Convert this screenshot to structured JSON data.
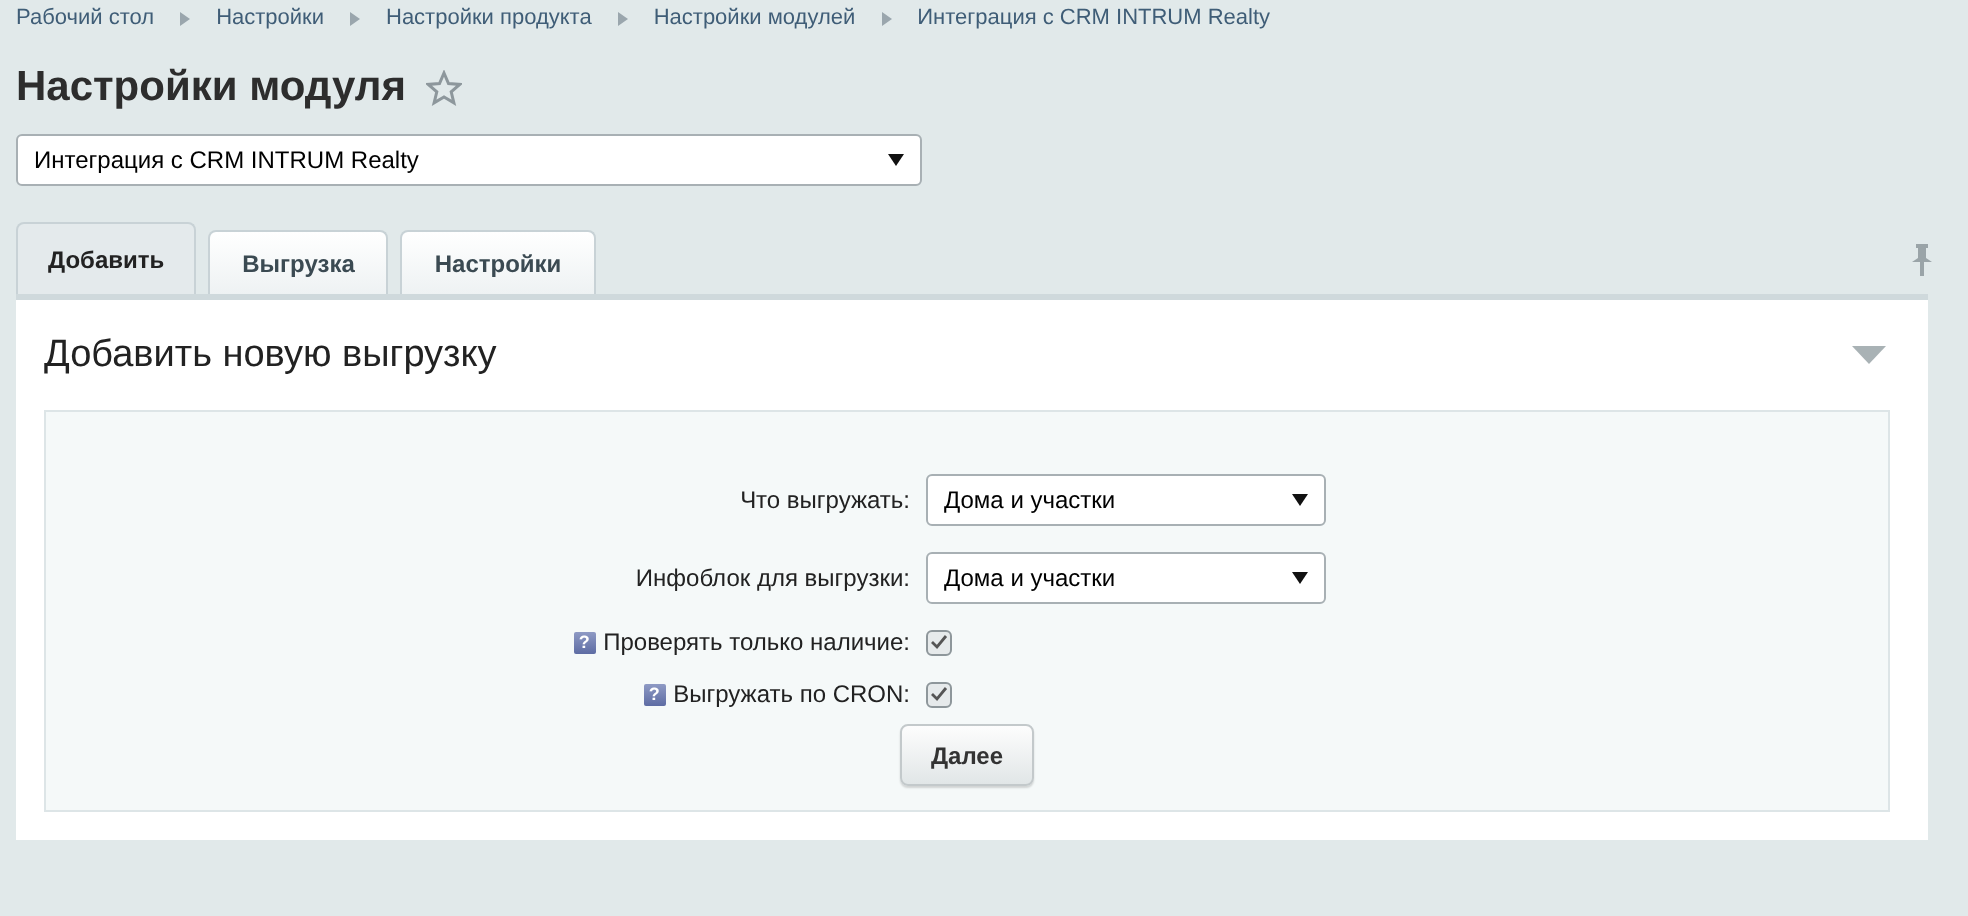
{
  "breadcrumbs": [
    "Рабочий стол",
    "Настройки",
    "Настройки продукта",
    "Настройки модулей",
    "Интеграция с CRM INTRUM Realty"
  ],
  "title": "Настройки модуля",
  "module_select": {
    "value": "Интеграция с CRM INTRUM Realty"
  },
  "tabs": [
    {
      "label": "Добавить",
      "selected": true
    },
    {
      "label": "Выгрузка",
      "selected": false
    },
    {
      "label": "Настройки",
      "selected": false
    }
  ],
  "section": {
    "title": "Добавить новую выгрузку",
    "expanded": true
  },
  "fields": [
    {
      "kind": "select",
      "label": "Что выгружать:",
      "value": "Дома и участки"
    },
    {
      "kind": "select",
      "label": "Инфоблок для выгрузки:",
      "value": "Дома и участки"
    },
    {
      "kind": "checkbox",
      "label": "Проверять только наличие:",
      "help": "?",
      "checked": true
    },
    {
      "kind": "checkbox",
      "label": "Выгружать по CRON:",
      "help": "?",
      "checked": true
    }
  ],
  "submit": "Далее"
}
